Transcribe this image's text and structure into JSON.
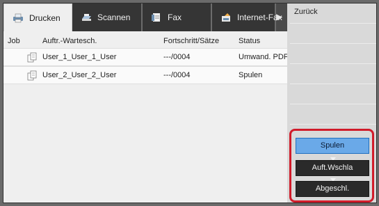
{
  "tabs": [
    {
      "label": "Drucken",
      "icon": "printer-icon"
    },
    {
      "label": "Scannen",
      "icon": "scanner-icon"
    },
    {
      "label": "Fax",
      "icon": "fax-icon"
    },
    {
      "label": "Internet-Fax",
      "icon": "internet-fax-icon"
    }
  ],
  "more_tabs_icon": "arrow-right-icon",
  "table": {
    "headers": {
      "job": "Job",
      "queue": "Auftr.-Wartesch.",
      "progress": "Fortschritt/Sätze",
      "status": "Status"
    },
    "rows": [
      {
        "queue": "User_1_User_1_User",
        "progress": "---/0004",
        "status": "Umwand. PDF"
      },
      {
        "queue": "User_2_User_2_User",
        "progress": "---/0004",
        "status": "Spulen"
      }
    ]
  },
  "side": {
    "back_label": "Zurück"
  },
  "status_buttons": {
    "spool": "Spulen",
    "queue": "Auft.Wschla",
    "done": "Abgeschl."
  },
  "colors": {
    "highlight": "#d11b2a",
    "selected_button": "#6aa9e8"
  }
}
